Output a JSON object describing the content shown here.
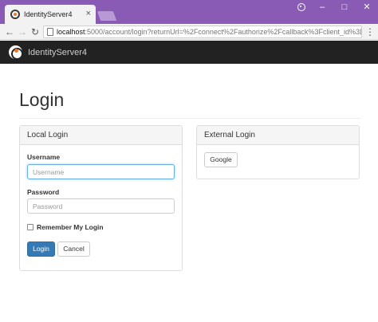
{
  "browser": {
    "tab_title": "IdentityServer4",
    "tab_close": "×",
    "url_host": "localhost",
    "url_rest": ":5000/account/login?returnUrl=%2Fconnect%2Fauthorize%2Fcallback%3Fclient_id%3Dm...",
    "controls": {
      "minimize": "–",
      "maximize": "□",
      "close": "✕"
    },
    "nav": {
      "back": "←",
      "forward": "→",
      "reload": "↻",
      "menu": "⋮"
    }
  },
  "navbar": {
    "brand": "IdentityServer4"
  },
  "page": {
    "title": "Login"
  },
  "local_login": {
    "heading": "Local Login",
    "username_label": "Username",
    "username_placeholder": "Username",
    "username_value": "",
    "password_label": "Password",
    "password_placeholder": "Password",
    "password_value": "",
    "remember_label": "Remember My Login",
    "remember_checked": false,
    "login_button": "Login",
    "cancel_button": "Cancel"
  },
  "external_login": {
    "heading": "External Login",
    "providers": [
      "Google"
    ]
  },
  "colors": {
    "titlebar": "#8a5bb5",
    "navbar": "#222222",
    "primary": "#337ab7"
  }
}
